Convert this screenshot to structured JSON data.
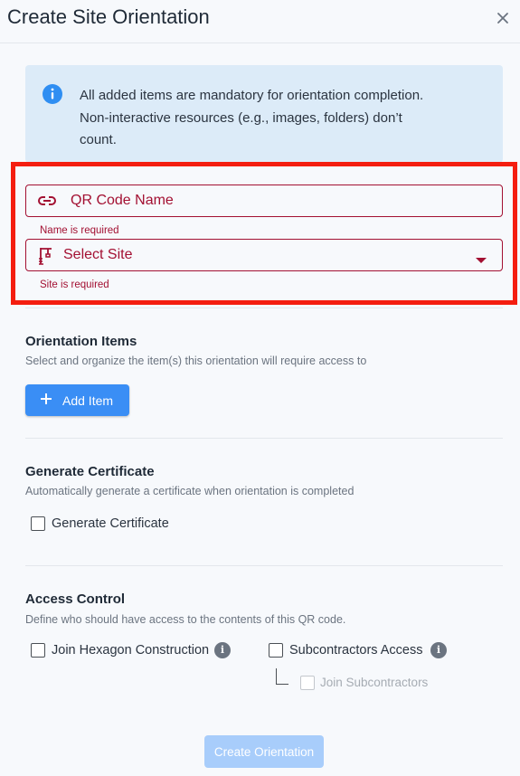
{
  "dialog": {
    "title": "Create Site Orientation",
    "close_icon": "close-icon"
  },
  "info": {
    "icon": "info-icon",
    "line1": "All added items are mandatory for orientation completion.",
    "line2": "Non-interactive resources (e.g., images, folders) don’t",
    "line3": "count."
  },
  "form": {
    "qr_code_name": {
      "placeholder": "QR Code Name",
      "value": "",
      "icon": "link-icon",
      "error": "Name is required"
    },
    "site": {
      "placeholder": "Select Site",
      "icon": "site-icon",
      "dropdown_icon": "caret-down-icon",
      "error": "Site is required"
    }
  },
  "orientation_items": {
    "title": "Orientation Items",
    "subtitle": "Select and organize the item(s) this orientation will require access to",
    "add_button": "Add Item"
  },
  "certificate": {
    "title": "Generate Certificate",
    "subtitle": "Automatically generate a certificate when orientation is completed",
    "checkbox_label": "Generate Certificate",
    "checked": false
  },
  "access_control": {
    "title": "Access Control",
    "subtitle": "Define who should have access to the contents of this QR code.",
    "join_hexagon": {
      "label": "Join Hexagon Construction",
      "checked": false
    },
    "subcontractors_access": {
      "label": "Subcontractors Access",
      "checked": false
    },
    "join_subcontractors": {
      "label": "Join Subcontractors",
      "checked": false,
      "disabled": true
    },
    "info_badge": "i"
  },
  "submit_button": "Create Orientation",
  "colors": {
    "error": "#a31032",
    "primary": "#3a8ef5",
    "primary_disabled": "#a8cdfb",
    "highlight_frame": "#f41e10",
    "info_background": "#dcebf8"
  }
}
